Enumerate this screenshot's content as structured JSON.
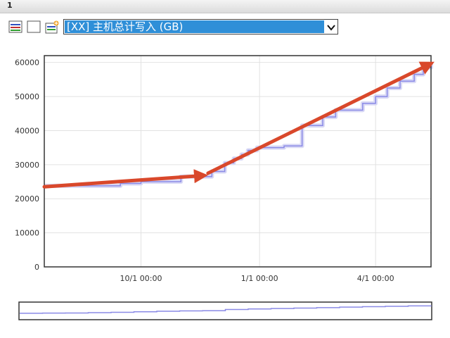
{
  "window": {
    "title": "1"
  },
  "toolbar": {
    "icons": [
      "chart-lines-icon",
      "blank-square-icon",
      "chart-add-icon"
    ]
  },
  "metric_select": {
    "value": "[XX] 主机总计写入 (GB)"
  },
  "chart_data": {
    "type": "line",
    "title": "",
    "xlabel": "",
    "ylabel": "",
    "ylim": [
      0,
      62000
    ],
    "y_ticks": [
      0,
      10000,
      20000,
      30000,
      40000,
      50000,
      60000
    ],
    "y_tick_labels": [
      "0",
      "10000",
      "20000",
      "30000",
      "40000",
      "50000",
      "60000"
    ],
    "x_range": [
      "2013-07-18",
      "2014-05-14"
    ],
    "x_ticks": [
      "2013-10-01",
      "2014-01-01",
      "2014-04-01"
    ],
    "x_tick_labels": [
      "10/1 00:00",
      "1/1 00:00",
      "4/1 00:00"
    ],
    "grid": true,
    "series": [
      {
        "x": [
          "2013-07-18",
          "2013-09-15",
          "2013-10-01",
          "2013-11-01",
          "2013-11-25",
          "2013-12-05",
          "2013-12-12",
          "2013-12-18",
          "2013-12-23",
          "2013-12-30",
          "2014-01-20",
          "2014-02-03",
          "2014-02-19",
          "2014-03-01",
          "2014-03-22",
          "2014-04-01",
          "2014-04-10",
          "2014-04-20",
          "2014-05-01",
          "2014-05-08",
          "2014-05-14"
        ],
        "y": [
          23800,
          24500,
          25000,
          26500,
          28000,
          30500,
          31800,
          33000,
          34200,
          35000,
          35500,
          41500,
          44000,
          46000,
          48000,
          50000,
          52500,
          54500,
          56500,
          58500,
          60000
        ]
      }
    ],
    "annotations": [
      {
        "type": "arrow",
        "from": [
          "2013-07-18",
          23500
        ],
        "to": [
          "2013-11-18",
          26800
        ]
      },
      {
        "type": "arrow",
        "from": [
          "2013-11-22",
          27500
        ],
        "to": [
          "2014-05-13",
          59500
        ]
      }
    ],
    "overview": {
      "y": [
        23800,
        24500,
        25000,
        26500,
        28000,
        30500,
        33000,
        35000,
        35500,
        41500,
        44000,
        46000,
        48000,
        50000,
        52500,
        54500,
        56500,
        58500,
        60000
      ]
    }
  }
}
